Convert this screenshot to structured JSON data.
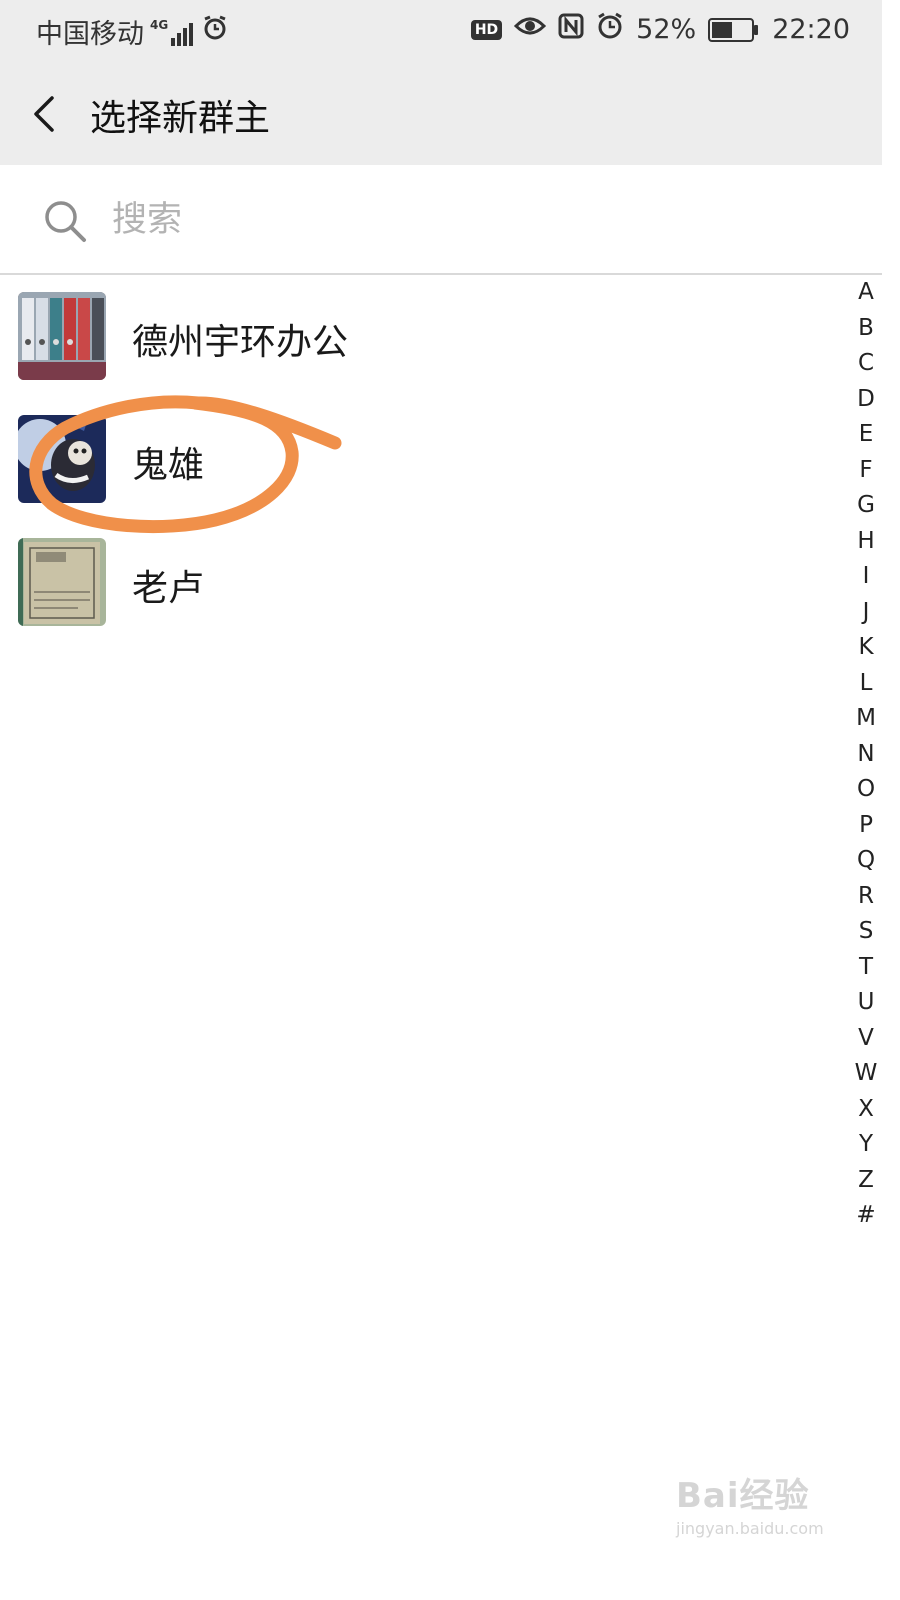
{
  "status_bar": {
    "carrier": "中国移动",
    "network": "4G",
    "battery_percent_text": "52%",
    "battery_level": 0.52,
    "time": "22:20",
    "hd_badge": "HD",
    "icons": [
      "signal-icon",
      "alarm-clock-icon",
      "hd-icon",
      "eye-icon",
      "nfc-icon",
      "alarm-icon",
      "battery-icon"
    ]
  },
  "header": {
    "title": "选择新群主",
    "back_icon": "chevron-left-icon"
  },
  "search": {
    "placeholder": "搜索",
    "icon": "search-icon"
  },
  "contacts": [
    {
      "name": "德州宇环办公"
    },
    {
      "name": "鬼雄"
    },
    {
      "name": "老卢"
    }
  ],
  "index_letters": [
    "A",
    "B",
    "C",
    "D",
    "E",
    "F",
    "G",
    "H",
    "I",
    "J",
    "K",
    "L",
    "M",
    "N",
    "O",
    "P",
    "Q",
    "R",
    "S",
    "T",
    "U",
    "V",
    "W",
    "X",
    "Y",
    "Z",
    "#"
  ],
  "annotation_color": "#f0904a",
  "watermark": {
    "main": "Bai经验",
    "sub": "jingyan.baidu.com"
  }
}
